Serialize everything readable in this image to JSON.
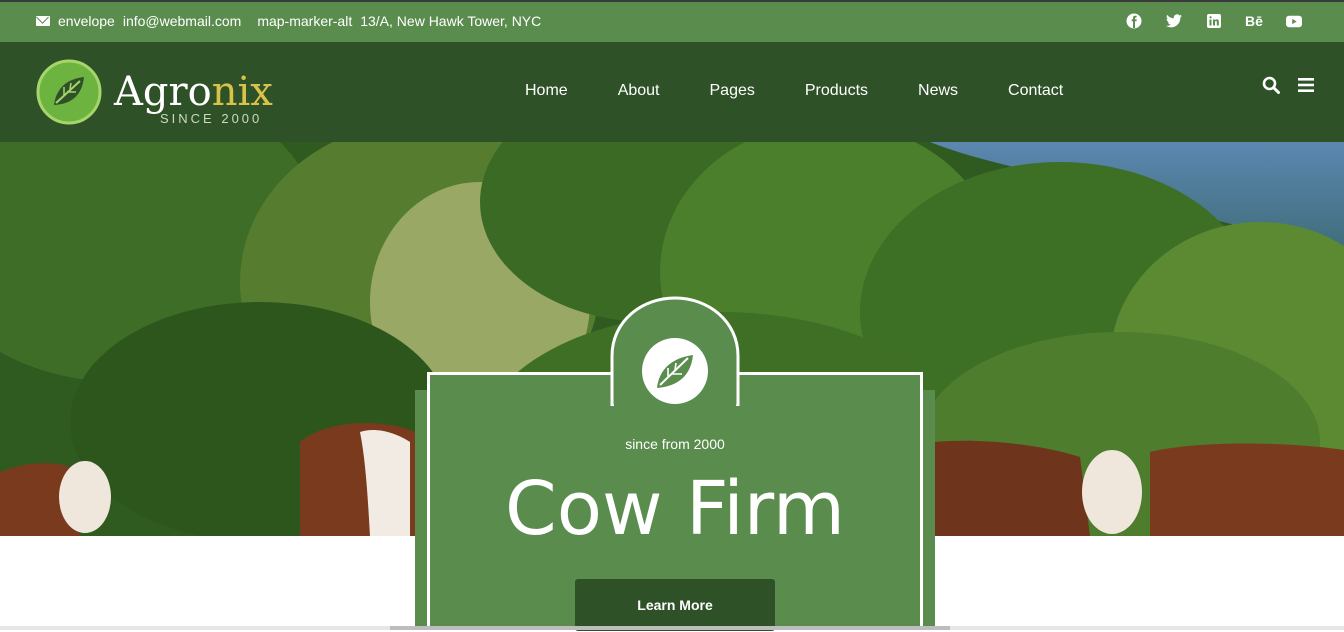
{
  "topbar": {
    "email_icon_text": "envelope",
    "email": "info@webmail.com",
    "address_icon_text": "map-marker-alt",
    "address": "13/A, New Hawk Tower, NYC",
    "social": [
      "facebook-icon",
      "twitter-icon",
      "linkedin-icon",
      "behance-icon",
      "youtube-icon"
    ]
  },
  "logo": {
    "name_a": "Agro",
    "name_b": "nix",
    "tagline": "SINCE 2000"
  },
  "nav": {
    "items": [
      "Home",
      "About",
      "Pages",
      "Products",
      "News",
      "Contact"
    ],
    "icons": [
      "search-icon",
      "menu-icon"
    ]
  },
  "hero": {
    "subtitle": "since from 2000",
    "title": "Cow Firm",
    "button": "Learn More"
  },
  "colors": {
    "topbar": "#5a8c4e",
    "navbar": "#2f5128",
    "accent": "#d9c24a",
    "card": "#5a8c4e"
  }
}
